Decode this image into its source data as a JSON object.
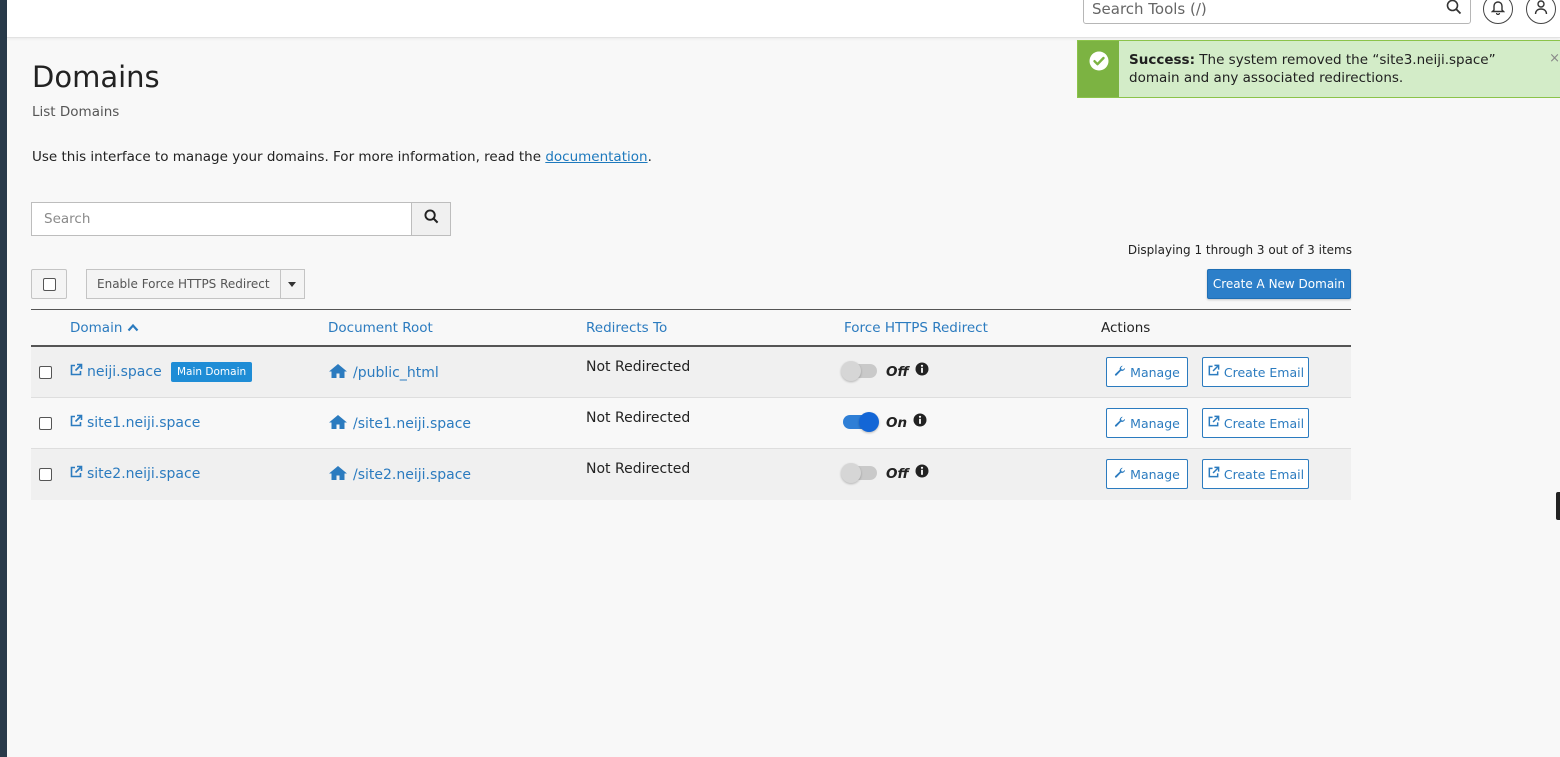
{
  "topbar": {
    "search_placeholder": "Search Tools (/)",
    "icons": [
      "search-icon",
      "bell-icon",
      "user-icon"
    ]
  },
  "alert": {
    "label": "Success:",
    "message": "The system removed the “site3.neiji.space” domain and any associated redirections.",
    "close": "×",
    "color": "#d3ecc8",
    "accent": "#7cb342"
  },
  "page": {
    "title": "Domains",
    "subtitle": "List Domains",
    "intro": "Use this interface to manage your domains. For more information, read the",
    "doc_link": "documentation",
    "intro_end": "."
  },
  "list": {
    "search_placeholder": "Search",
    "displaying": "Displaying 1 through 3 out of 3 items",
    "bulk_action": "Enable Force HTTPS Redirect",
    "create_button": "Create A New Domain",
    "columns": {
      "domain": "Domain",
      "docroot": "Document Root",
      "redirects": "Redirects To",
      "https": "Force HTTPS Redirect",
      "actions": "Actions"
    },
    "rows": [
      {
        "domain": "neiji.space",
        "badge": "Main Domain",
        "docroot": "/public_html",
        "redirect": "Not Redirected",
        "https_on": false,
        "https_label": "Off",
        "manage": "Manage",
        "email": "Create Email"
      },
      {
        "domain": "site1.neiji.space",
        "badge": "",
        "docroot": "/site1.neiji.space",
        "redirect": "Not Redirected",
        "https_on": true,
        "https_label": "On",
        "manage": "Manage",
        "email": "Create Email"
      },
      {
        "domain": "site2.neiji.space",
        "badge": "",
        "docroot": "/site2.neiji.space",
        "redirect": "Not Redirected",
        "https_on": false,
        "https_label": "Off",
        "manage": "Manage",
        "email": "Create Email"
      }
    ]
  },
  "colors": {
    "link": "#2b7bbf",
    "primary_button": "#2c7fc9",
    "badge": "#1f8dd6",
    "toggle_on": "#1366d6"
  }
}
